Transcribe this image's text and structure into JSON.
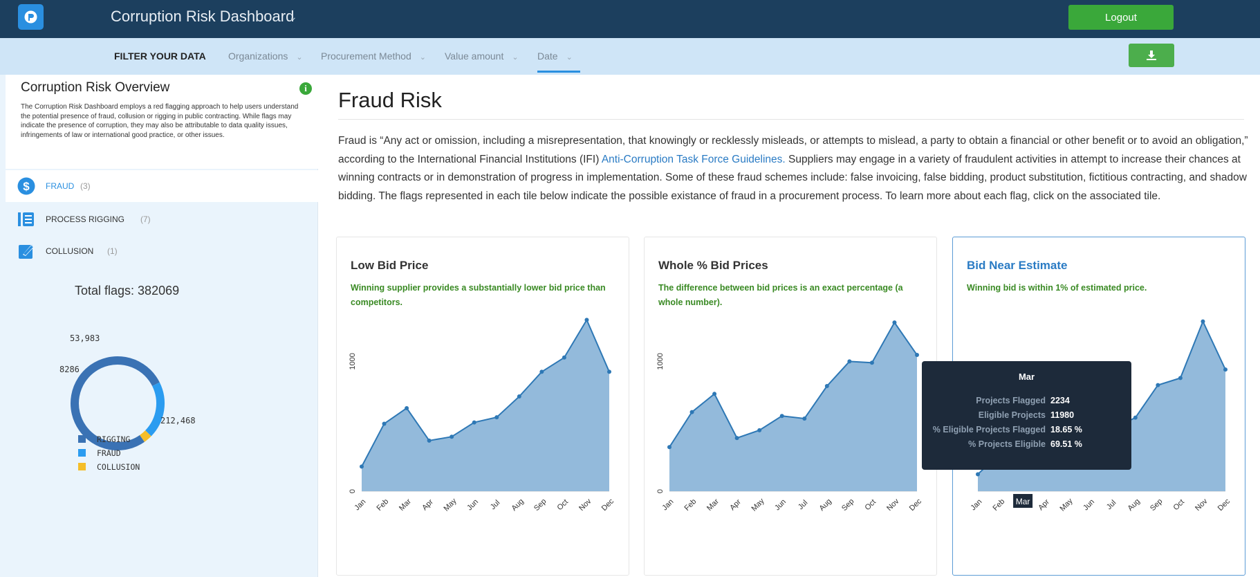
{
  "header": {
    "title": "Corruption Risk Dashboard",
    "logout_label": "Logout"
  },
  "filters": {
    "heading": "FILTER YOUR DATA",
    "tabs": [
      "Organizations",
      "Procurement Method",
      "Value amount",
      "Date"
    ],
    "active_tab": "Date"
  },
  "sidebar": {
    "overview_title": "Corruption Risk Overview",
    "overview_text": "The Corruption Risk Dashboard employs a red flagging approach to help users understand the potential presence of fraud, collusion or rigging in public contracting. While flags may indicate the presence of corruption, they may also be attributable to data quality issues, infringements of law or international good practice, or other issues.",
    "categories": [
      {
        "label": "FRAUD",
        "count": "(3)",
        "icon": "dollar-icon",
        "active": true
      },
      {
        "label": "PROCESS RIGGING",
        "count": "(7)",
        "icon": "rigging-icon",
        "active": false
      },
      {
        "label": "COLLUSION",
        "count": "(1)",
        "icon": "collusion-icon",
        "active": false
      }
    ],
    "total_flags": "Total flags: 382069",
    "donut": {
      "labels": [
        "53,983",
        "8286",
        "212,468"
      ],
      "values": [
        212468,
        53983,
        8286
      ],
      "colors": [
        "#3a72b4",
        "#2b9cf0",
        "#f5be29"
      ],
      "legend": [
        {
          "name": "RIGGING",
          "color": "#3a72b4"
        },
        {
          "name": "FRAUD",
          "color": "#2b9cf0"
        },
        {
          "name": "COLLUSION",
          "color": "#f5be29"
        }
      ]
    }
  },
  "main": {
    "title": "Fraud Risk",
    "desc_before": "Fraud is “Any act or omission, including a misrepresentation, that knowingly or recklessly misleads, or attempts to mislead, a party to obtain a financial or other benefit or to avoid an obligation,” according to the International Financial Institutions (IFI) ",
    "desc_link": "Anti-Corruption Task Force Guidelines.",
    "desc_after": " Suppliers may engage in a variety of fraudulent activities in attempt to increase their chances at winning contracts or in demonstration of progress in implementation. Some of these fraud schemes include: false invoicing, false bidding, product substitution, fictitious contracting, and shadow bidding. The flags represented in each tile below indicate the possible existance of fraud in a procurement process. To learn more about each flag, click on the associated tile."
  },
  "tiles": [
    {
      "title": "Low Bid Price",
      "subtitle": "Winning supplier provides a substantially lower bid price than competitors.",
      "selected": false
    },
    {
      "title": "Whole % Bid Prices",
      "subtitle": "The difference between bid prices is an exact percentage (a whole number).",
      "selected": false
    },
    {
      "title": "Bid Near Estimate",
      "subtitle": "Winning bid is within 1% of estimated price.",
      "selected": true
    }
  ],
  "tooltip": {
    "title": "Mar",
    "rows": [
      {
        "label": "Projects Flagged",
        "value": "2234"
      },
      {
        "label": "Eligible Projects",
        "value": "11980"
      },
      {
        "label": "% Eligible Projects Flagged",
        "value": "18.65 %"
      },
      {
        "label": "% Projects Eligible",
        "value": "69.51 %"
      }
    ],
    "point_label": "2234",
    "axis_label": "Mar"
  },
  "chart_data": [
    {
      "type": "area",
      "title": "Low Bid Price",
      "categories": [
        "Jan",
        "Feb",
        "Mar",
        "Apr",
        "May",
        "Jun",
        "Jul",
        "Aug",
        "Sep",
        "Oct",
        "Nov",
        "Dec"
      ],
      "values": [
        190,
        520,
        640,
        390,
        420,
        530,
        570,
        730,
        920,
        1030,
        1320,
        920
      ],
      "yticks": [
        0,
        1000
      ],
      "ylim": [
        0,
        1450
      ],
      "color": "#8db6d9"
    },
    {
      "type": "area",
      "title": "Whole % Bid Prices",
      "categories": [
        "Jan",
        "Feb",
        "Mar",
        "Apr",
        "May",
        "Jun",
        "Jul",
        "Aug",
        "Sep",
        "Oct",
        "Nov",
        "Dec"
      ],
      "values": [
        340,
        610,
        750,
        410,
        470,
        580,
        560,
        810,
        1000,
        990,
        1300,
        1050
      ],
      "yticks": [
        0,
        1000
      ],
      "ylim": [
        0,
        1450
      ],
      "color": "#8db6d9"
    },
    {
      "type": "area",
      "title": "Bid Near Estimate",
      "categories": [
        "Jan",
        "Feb",
        "Mar",
        "Apr",
        "May",
        "Jun",
        "Jul",
        "Aug",
        "Sep",
        "Oct",
        "Nov",
        "Dec"
      ],
      "values": [
        1200,
        2700,
        3700,
        2900,
        3000,
        3700,
        4400,
        5200,
        7500,
        8000,
        12000,
        8600
      ],
      "yticks": [],
      "ylim": [
        0,
        13300
      ],
      "color": "#8db6d9",
      "highlight_index": 2
    }
  ]
}
